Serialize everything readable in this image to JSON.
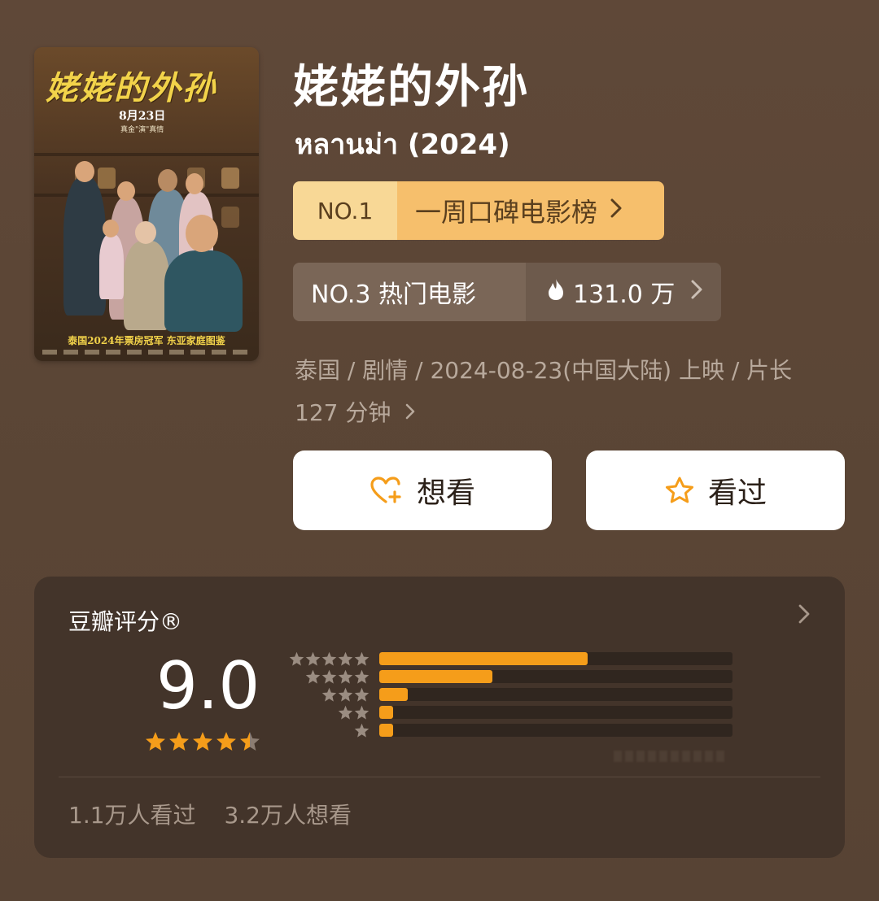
{
  "movie": {
    "title": "姥姥的外孙",
    "original_title": "หลานม่า (2024)",
    "poster": {
      "title": "姥姥的外孙",
      "date": "8月23日",
      "tagline_small": "真金\"演\"真情",
      "tagline": "泰国2024年票房冠军  东亚家庭图鉴"
    }
  },
  "rank_primary": {
    "number": "NO.1",
    "label": "一周口碑电影榜",
    "chevron": "chevron-right-icon"
  },
  "rank_secondary": {
    "label": "NO.3 热门电影",
    "heat": "131.0 万",
    "icon": "fire-icon",
    "chevron": "chevron-right-icon"
  },
  "meta": {
    "line1": "泰国 / 剧情 / 2024-08-23(中国大陆) 上映 / 片长",
    "line2": "127 分钟"
  },
  "actions": {
    "want": {
      "label": "想看",
      "icon": "heart-plus-icon"
    },
    "seen": {
      "label": "看过",
      "icon": "star-outline-icon"
    }
  },
  "rating": {
    "title": "豆瓣评分®",
    "score": "9.0",
    "stars": 4.5,
    "distribution": [
      {
        "stars": 5,
        "fraction": 0.59
      },
      {
        "stars": 4,
        "fraction": 0.32
      },
      {
        "stars": 3,
        "fraction": 0.08
      },
      {
        "stars": 2,
        "fraction": 0.04
      },
      {
        "stars": 1,
        "fraction": 0.04
      }
    ],
    "seen_count": "1.1万人看过",
    "want_count": "3.2万人想看"
  },
  "colors": {
    "background": "#5b4636",
    "card": "#43342a",
    "accent": "#f59d1a",
    "rank_highlight": "#f6bf6c",
    "rank_highlight_light": "#f8d896"
  }
}
